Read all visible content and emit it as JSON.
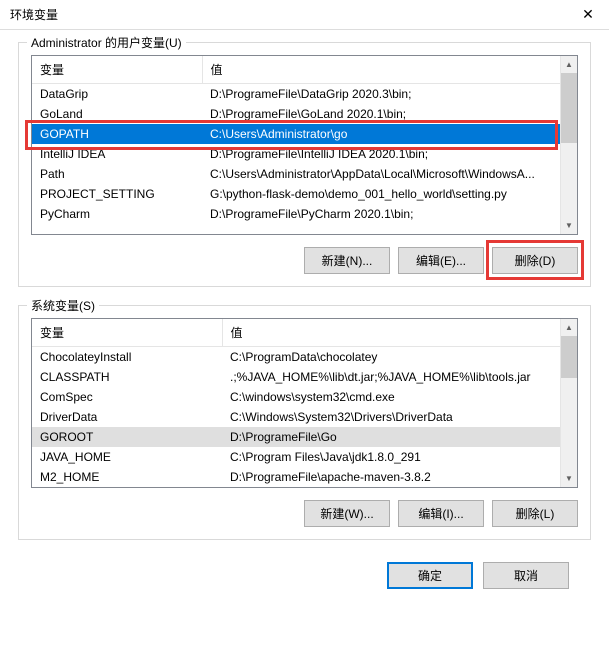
{
  "window": {
    "title": "环境变量"
  },
  "user_group": {
    "label": "Administrator 的用户变量(U)",
    "col_var": "变量",
    "col_val": "值",
    "rows": [
      {
        "name": "DataGrip",
        "value": "D:\\ProgrameFile\\DataGrip 2020.3\\bin;"
      },
      {
        "name": "GoLand",
        "value": "D:\\ProgrameFile\\GoLand 2020.1\\bin;"
      },
      {
        "name": "GOPATH",
        "value": "C:\\Users\\Administrator\\go",
        "selected": true
      },
      {
        "name": "IntelliJ IDEA",
        "value": "D:\\ProgrameFile\\IntelliJ IDEA 2020.1\\bin;"
      },
      {
        "name": "Path",
        "value": "C:\\Users\\Administrator\\AppData\\Local\\Microsoft\\WindowsA..."
      },
      {
        "name": "PROJECT_SETTING",
        "value": "G:\\python-flask-demo\\demo_001_hello_world\\setting.py"
      },
      {
        "name": "PyCharm",
        "value": "D:\\ProgrameFile\\PyCharm 2020.1\\bin;"
      }
    ],
    "buttons": {
      "new": "新建(N)...",
      "edit": "编辑(E)...",
      "delete": "删除(D)"
    }
  },
  "sys_group": {
    "label": "系统变量(S)",
    "col_var": "变量",
    "col_val": "值",
    "rows": [
      {
        "name": "ChocolateyInstall",
        "value": "C:\\ProgramData\\chocolatey"
      },
      {
        "name": "CLASSPATH",
        "value": ".;%JAVA_HOME%\\lib\\dt.jar;%JAVA_HOME%\\lib\\tools.jar"
      },
      {
        "name": "ComSpec",
        "value": "C:\\windows\\system32\\cmd.exe"
      },
      {
        "name": "DriverData",
        "value": "C:\\Windows\\System32\\Drivers\\DriverData"
      },
      {
        "name": "GOROOT",
        "value": "D:\\ProgrameFile\\Go",
        "selected": true
      },
      {
        "name": "JAVA_HOME",
        "value": "C:\\Program Files\\Java\\jdk1.8.0_291"
      },
      {
        "name": "M2_HOME",
        "value": "D:\\ProgrameFile\\apache-maven-3.8.2"
      }
    ],
    "buttons": {
      "new": "新建(W)...",
      "edit": "编辑(I)...",
      "delete": "删除(L)"
    }
  },
  "footer": {
    "ok": "确定",
    "cancel": "取消"
  }
}
